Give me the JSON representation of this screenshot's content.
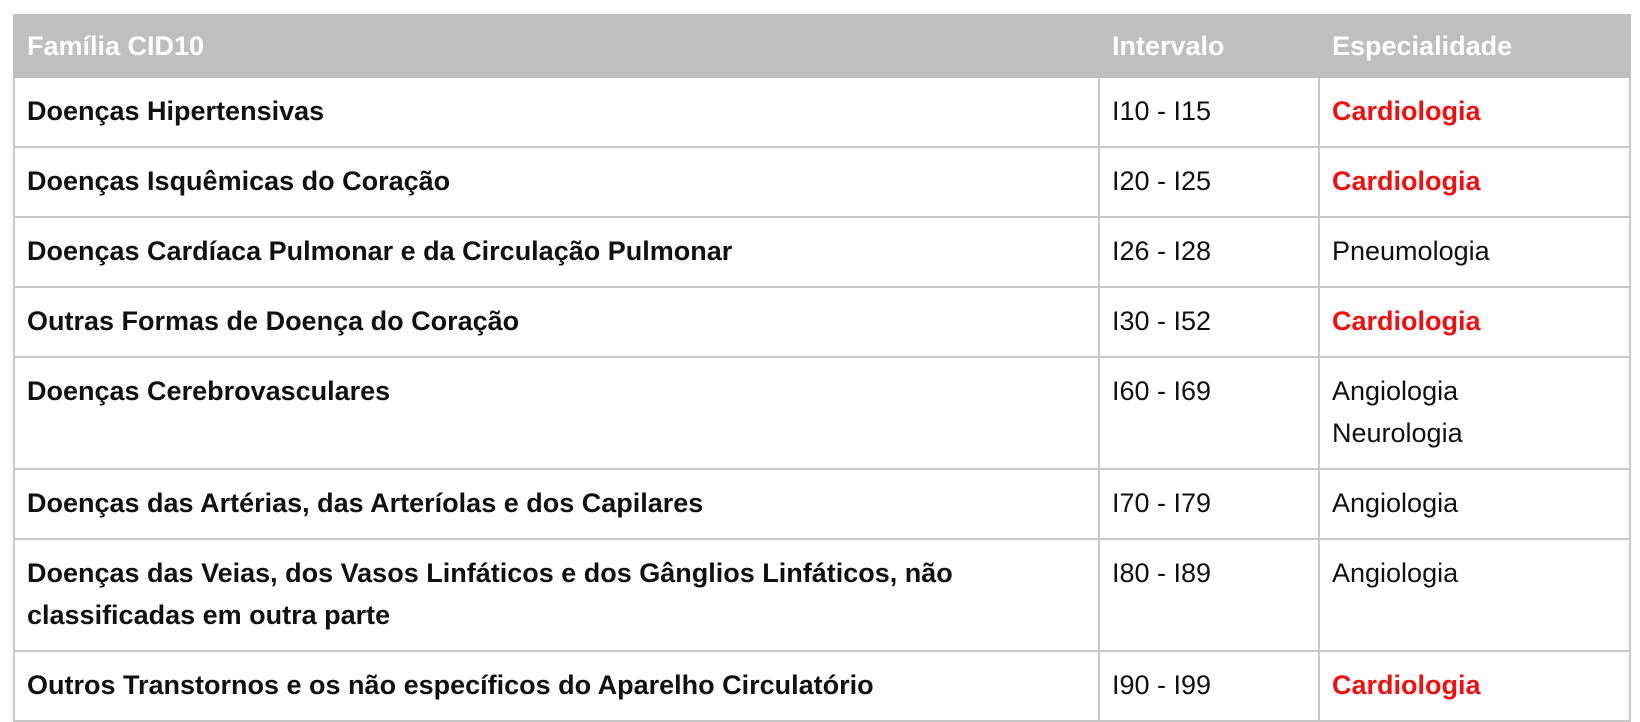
{
  "table": {
    "headers": [
      "Família CID10",
      "Intervalo",
      "Especialidade"
    ],
    "colors": {
      "header_bg": "#bfbfbf",
      "header_text": "#ffffff",
      "highlight": "#ee1111",
      "border": "#c8c8c8"
    },
    "rows": [
      {
        "family": "Doenças Hipertensivas",
        "range": "I10 - I15",
        "specialties": [
          {
            "text": "Cardiologia",
            "highlight": true
          }
        ]
      },
      {
        "family": "Doenças Isquêmicas do Coração",
        "range": "I20 - I25",
        "specialties": [
          {
            "text": "Cardiologia",
            "highlight": true
          }
        ]
      },
      {
        "family": "Doenças Cardíaca Pulmonar e da Circulação Pulmonar",
        "range": "I26 - I28",
        "specialties": [
          {
            "text": "Pneumologia",
            "highlight": false
          }
        ]
      },
      {
        "family": "Outras Formas de Doença do Coração",
        "range": "I30 - I52",
        "specialties": [
          {
            "text": "Cardiologia",
            "highlight": true
          }
        ]
      },
      {
        "family": "Doenças Cerebrovasculares",
        "range": "I60 - I69",
        "specialties": [
          {
            "text": "Angiologia",
            "highlight": false
          },
          {
            "text": "Neurologia",
            "highlight": false
          }
        ]
      },
      {
        "family": "Doenças das Artérias, das Arteríolas e dos Capilares",
        "range": "I70 - I79",
        "specialties": [
          {
            "text": "Angiologia",
            "highlight": false
          }
        ]
      },
      {
        "family": "Doenças das Veias, dos Vasos Linfáticos e dos Gânglios Linfáticos, não classificadas em outra parte",
        "range": "I80 - I89",
        "specialties": [
          {
            "text": "Angiologia",
            "highlight": false
          }
        ]
      },
      {
        "family": "Outros Transtornos e os não específicos do Aparelho Circulatório",
        "range": "I90 - I99",
        "specialties": [
          {
            "text": "Cardiologia",
            "highlight": true
          }
        ]
      }
    ]
  }
}
